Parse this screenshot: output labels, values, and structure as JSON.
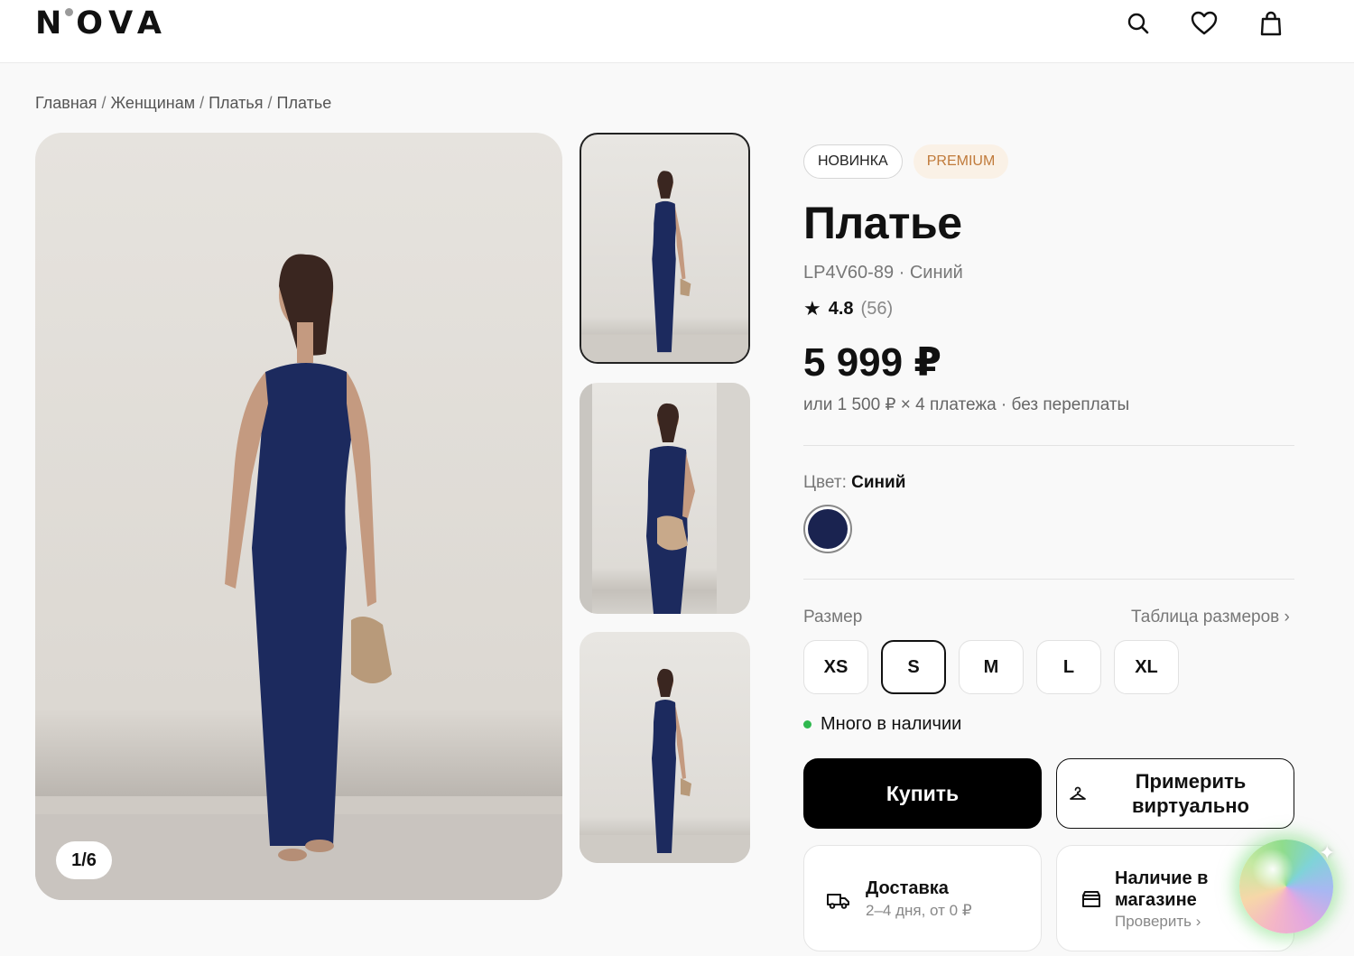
{
  "header": {
    "logo_left": "N",
    "logo_right": "OVA",
    "icons": [
      "search-icon",
      "heart-icon",
      "bag-icon"
    ]
  },
  "breadcrumb": [
    "Главная",
    "Женщинам",
    "Платья",
    "Платье"
  ],
  "gallery": {
    "counter": "1/6",
    "thumbnail_count": 3,
    "selected_thumbnail": 1
  },
  "product": {
    "badges": [
      "НОВИНКА",
      "PREMIUM"
    ],
    "title": "Платье",
    "sku": "LP4V60-89 · Синий",
    "rating": {
      "star": "★",
      "score": "4.8",
      "count": "(56)"
    },
    "price": "5 999 ₽",
    "installment": "или 1 500 ₽ × 4 платежа · без переплаты"
  },
  "color": {
    "label": "Цвет:",
    "selected": "Синий",
    "swatch_hex": "#1a2350"
  },
  "size": {
    "label": "Размер",
    "chart_link": "Таблица размеров ›",
    "options": [
      "XS",
      "S",
      "M",
      "L",
      "XL"
    ],
    "selected": "S"
  },
  "stock": {
    "text": "Много в наличии",
    "dot_color": "#2fb84f"
  },
  "actions": {
    "buy": "Купить",
    "try_on": "Примерить виртуально"
  },
  "cards": {
    "delivery": {
      "title": "Доставка",
      "subtitle": "2–4 дня, от 0 ₽"
    },
    "store": {
      "title": "Наличие в магазине",
      "subtitle": "Проверить ›"
    }
  },
  "colors": {
    "accent": "#000000",
    "premium_text": "#c07a3a",
    "premium_bg": "#faf1e6",
    "dress": "#1c2a5e"
  }
}
